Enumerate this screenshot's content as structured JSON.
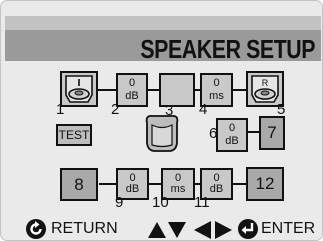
{
  "title": "SPEAKER SETUP",
  "speakers": {
    "front_left_letter": "L",
    "front_right_letter": "R"
  },
  "cells": {
    "c2": {
      "value": "0",
      "unit": "dB"
    },
    "c4": {
      "value": "0",
      "unit": "ms"
    },
    "c6": {
      "value": "0",
      "unit": "dB"
    },
    "c7": "7",
    "c8": "8",
    "c9": {
      "value": "0",
      "unit": "dB"
    },
    "c10": {
      "value": "0",
      "unit": "ms"
    },
    "c11": {
      "value": "0",
      "unit": "dB"
    },
    "c12": "12"
  },
  "callouts": [
    "1",
    "2",
    "3",
    "4",
    "5",
    "6",
    "9",
    "10",
    "11"
  ],
  "test_label": "TEST",
  "footer": {
    "return_label": "RETURN",
    "enter_label": "ENTER"
  },
  "icons": {
    "return": "return-icon",
    "up_down": "up-down-arrows-icon",
    "left_right": "left-right-arrows-icon",
    "enter": "enter-icon"
  }
}
